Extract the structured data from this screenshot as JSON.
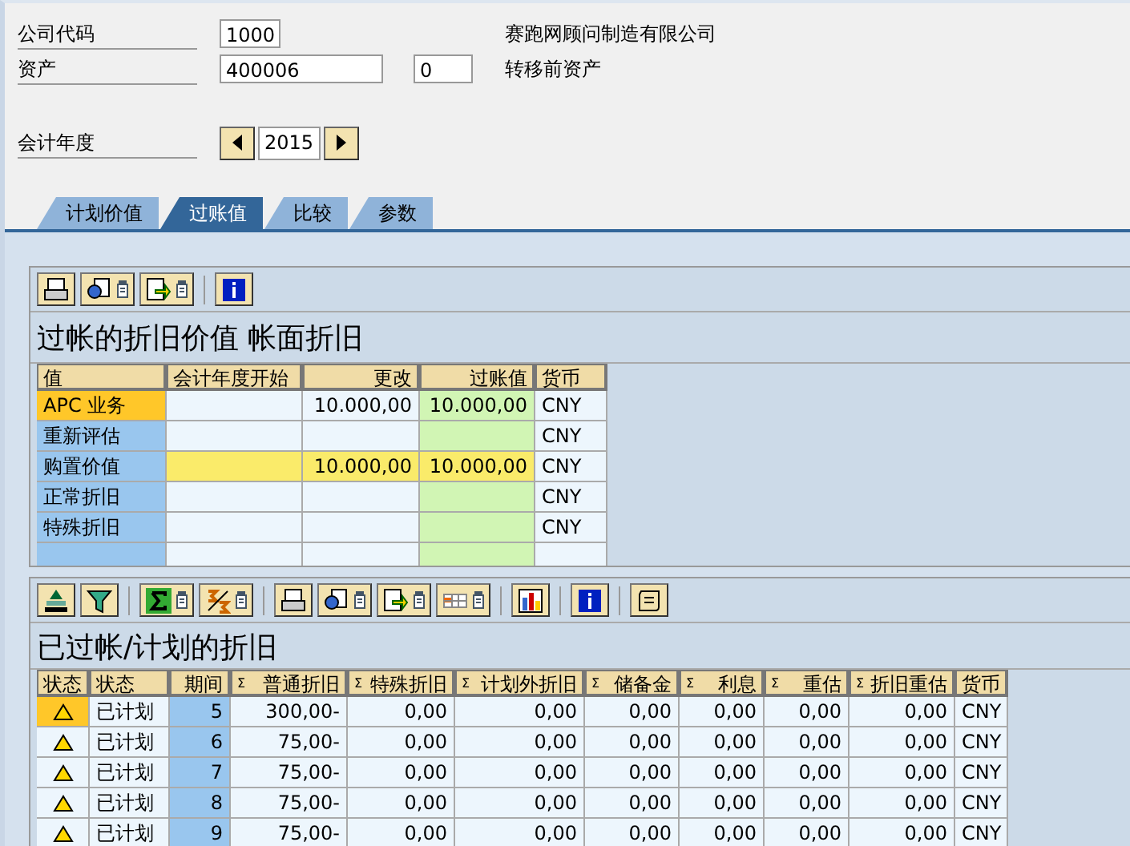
{
  "header": {
    "fields": [
      {
        "label": "公司代码",
        "values": [
          "1000"
        ],
        "description": "赛跑网顾问制造有限公司"
      },
      {
        "label": "资产",
        "values": [
          "400006",
          "0"
        ],
        "description": "转移前资产"
      }
    ],
    "fiscal_year": {
      "label": "会计年度",
      "value": "2015"
    }
  },
  "tabs": [
    {
      "label": "计划价值",
      "selected": false
    },
    {
      "label": "过账值",
      "selected": true
    },
    {
      "label": "比较",
      "selected": false
    },
    {
      "label": "参数",
      "selected": false
    }
  ],
  "values_table": {
    "title": "过帐的折旧价值 帐面折旧",
    "columns": [
      "值",
      "会计年度开始",
      "更改",
      "过账值",
      "货币"
    ],
    "rows": [
      {
        "kind": "normal",
        "selected": true,
        "cells": [
          "APC 业务",
          "",
          "10.000,00",
          "10.000,00",
          "CNY"
        ]
      },
      {
        "kind": "normal",
        "selected": false,
        "cells": [
          "重新评估",
          "",
          "",
          "",
          "CNY"
        ]
      },
      {
        "kind": "total",
        "selected": false,
        "cells": [
          "购置价值",
          "",
          "10.000,00",
          "10.000,00",
          "CNY"
        ]
      },
      {
        "kind": "normal",
        "selected": false,
        "cells": [
          "正常折旧",
          "",
          "",
          "",
          "CNY"
        ]
      },
      {
        "kind": "normal",
        "selected": false,
        "cells": [
          "特殊折旧",
          "",
          "",
          "",
          "CNY"
        ]
      }
    ]
  },
  "depreciation_table": {
    "title": "已过帐/计划的折旧",
    "columns": [
      {
        "label": "状态"
      },
      {
        "label": "状态"
      },
      {
        "label": "期间"
      },
      {
        "label": "普通折旧",
        "mark": "Σ"
      },
      {
        "label": "特殊折旧",
        "mark": "Σ"
      },
      {
        "label": "计划外折旧",
        "mark": "Σ"
      },
      {
        "label": "储备金",
        "mark": "Σ"
      },
      {
        "label": "利息",
        "mark": "Σ"
      },
      {
        "label": "重估",
        "mark": "Σ"
      },
      {
        "label": "折旧重估",
        "mark": "Σ"
      },
      {
        "label": "货币"
      }
    ],
    "rows": [
      {
        "kind": "warning",
        "selected": true,
        "cells": [
          "",
          "已计划",
          "5",
          "300,00-",
          "0,00",
          "0,00",
          "0,00",
          "0,00",
          "0,00",
          "0,00",
          "CNY"
        ]
      },
      {
        "kind": "warning",
        "selected": false,
        "cells": [
          "",
          "已计划",
          "6",
          "75,00-",
          "0,00",
          "0,00",
          "0,00",
          "0,00",
          "0,00",
          "0,00",
          "CNY"
        ]
      },
      {
        "kind": "warning",
        "selected": false,
        "cells": [
          "",
          "已计划",
          "7",
          "75,00-",
          "0,00",
          "0,00",
          "0,00",
          "0,00",
          "0,00",
          "0,00",
          "CNY"
        ]
      },
      {
        "kind": "warning",
        "selected": false,
        "cells": [
          "",
          "已计划",
          "8",
          "75,00-",
          "0,00",
          "0,00",
          "0,00",
          "0,00",
          "0,00",
          "0,00",
          "CNY"
        ]
      },
      {
        "kind": "warning",
        "selected": false,
        "cells": [
          "",
          "已计划",
          "9",
          "75,00-",
          "0,00",
          "0,00",
          "0,00",
          "0,00",
          "0,00",
          "0,00",
          "CNY"
        ]
      }
    ]
  }
}
